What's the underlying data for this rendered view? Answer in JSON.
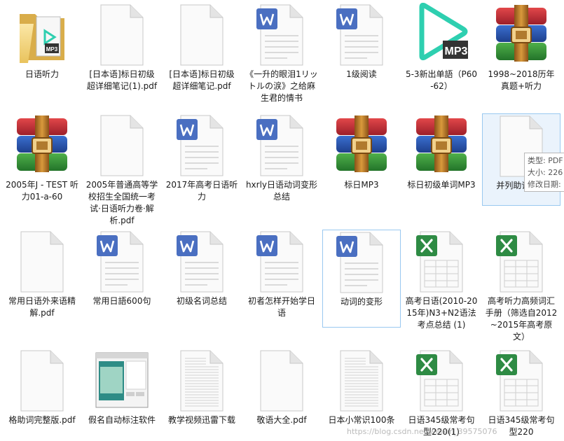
{
  "tooltip": {
    "lines": [
      "类型: PDF",
      "大小: 226",
      "修改日期:"
    ]
  },
  "watermark": "https://blog.csdn.net/weixin_39575076",
  "items": [
    {
      "label": "日语听力",
      "icon": "folder-mp3"
    },
    {
      "label": "[日本语]标日初级超详细笔记(1).pdf",
      "icon": "pdf-file"
    },
    {
      "label": "[日本语]标日初级超详细笔记.pdf",
      "icon": "pdf-file"
    },
    {
      "label": "《一升的眼泪1リットルの涙》之给麻生君的情书",
      "icon": "wps-doc"
    },
    {
      "label": "1级阅读",
      "icon": "wps-doc"
    },
    {
      "label": "5-3新出单語（P60-62）",
      "icon": "mp3-file"
    },
    {
      "label": "1998~2018历年真题+听力",
      "icon": "rar-archive"
    },
    {
      "label": "2005年J - TEST 听力01-a-60",
      "icon": "rar-archive"
    },
    {
      "label": "2005年普通高等学校招生全国统一考试·日语听力卷·解析.pdf",
      "icon": "pdf-file"
    },
    {
      "label": "2017年高考日语听力",
      "icon": "wps-doc"
    },
    {
      "label": "hxrly日语动词变形总结",
      "icon": "wps-doc"
    },
    {
      "label": "标日MP3",
      "icon": "rar-archive"
    },
    {
      "label": "标日初级单词MP3",
      "icon": "rar-archive"
    },
    {
      "label": "并列助词.pdf",
      "icon": "pdf-file"
    },
    {
      "label": "常用日语外来语精解.pdf",
      "icon": "pdf-file"
    },
    {
      "label": "常用日語600句",
      "icon": "wps-doc"
    },
    {
      "label": "初级名词总结",
      "icon": "wps-doc"
    },
    {
      "label": "初者怎样开始学日语",
      "icon": "wps-doc"
    },
    {
      "label": "动词的变形",
      "icon": "wps-doc"
    },
    {
      "label": "高考日语(2010-2015年)N3+N2语法考点总结 (1)",
      "icon": "excel-file"
    },
    {
      "label": "高考听力高频词汇手册（筛选自2012~2015年高考原文）",
      "icon": "excel-file"
    },
    {
      "label": "格助词完整版.pdf",
      "icon": "pdf-file"
    },
    {
      "label": "假名自动标注软件",
      "icon": "app-window"
    },
    {
      "label": "教学视频迅雷下载",
      "icon": "text-file"
    },
    {
      "label": "敬语大全.pdf",
      "icon": "pdf-file"
    },
    {
      "label": "日本小常识100条",
      "icon": "text-file"
    },
    {
      "label": "日语345级常考句型220(1)",
      "icon": "excel-file"
    },
    {
      "label": "日语345级常考句型220",
      "icon": "excel-file"
    }
  ]
}
